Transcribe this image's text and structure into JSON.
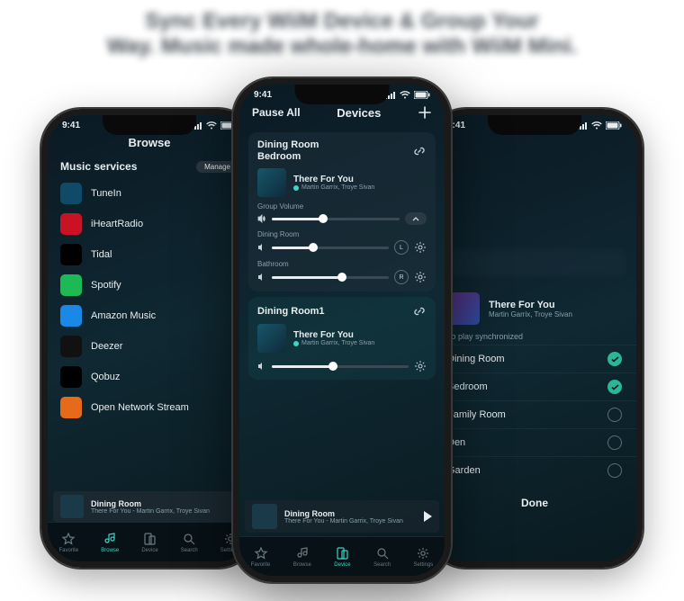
{
  "headline_line1": "Sync Every WiiM Device & Group Your",
  "headline_line2": "Way. Music made whole-home with WiiM Mini.",
  "status_time": "9:41",
  "left": {
    "title": "Browse",
    "section": "Music services",
    "manage": "Manage",
    "services": [
      {
        "name": "TuneIn",
        "bg": "#0f4b68",
        "fg": "#ffffff"
      },
      {
        "name": "iHeartRadio",
        "bg": "#c91224",
        "fg": "#ffffff"
      },
      {
        "name": "Tidal",
        "bg": "#000000",
        "fg": "#ffffff"
      },
      {
        "name": "Spotify",
        "bg": "#1db954",
        "fg": "#ffffff"
      },
      {
        "name": "Amazon Music",
        "bg": "#1a88e6",
        "fg": "#ffffff"
      },
      {
        "name": "Deezer",
        "bg": "#111111",
        "fg": "#ffffff"
      },
      {
        "name": "Qobuz",
        "bg": "#000000",
        "fg": "#ffffff"
      },
      {
        "name": "Open Network Stream",
        "bg": "#e66a1a",
        "fg": "#ffffff"
      }
    ],
    "nowplaying": {
      "room": "Dining Room",
      "track": "There For You - Martin Garrix, Troye Sivan"
    }
  },
  "center": {
    "pause_all": "Pause All",
    "title": "Devices",
    "card1": {
      "rooms": "Dining Room\nBedroom",
      "track": {
        "title": "There For You",
        "artist": "Martin Garrix, Troye Sivan"
      },
      "group_label": "Group Volume",
      "group_vol": 40,
      "room_a": {
        "name": "Dining Room",
        "vol": 35,
        "badge": "L"
      },
      "room_b": {
        "name": "Bathroom",
        "vol": 60,
        "badge": "R"
      }
    },
    "card2": {
      "room": "Dining Room1",
      "track": {
        "title": "There For You",
        "artist": "Martin Garrix, Troye Sivan"
      },
      "vol": 45
    },
    "nowplaying": {
      "room": "Dining Room",
      "track": "There For You - Martin Garrix, Troye Sivan"
    }
  },
  "right": {
    "track": {
      "title": "There For You",
      "artist": "Martin Garrix, Troye Sivan"
    },
    "sync_label": "To play synchronized",
    "rooms": [
      {
        "name": "Dining Room",
        "selected": true
      },
      {
        "name": "Bedroom",
        "selected": true
      },
      {
        "name": "Family Room",
        "selected": false
      },
      {
        "name": "Den",
        "selected": false
      },
      {
        "name": "Garden",
        "selected": false
      }
    ],
    "done": "Done"
  },
  "tabs": [
    {
      "label": "Favorite"
    },
    {
      "label": "Browse"
    },
    {
      "label": "Device"
    },
    {
      "label": "Search"
    },
    {
      "label": "Settings"
    }
  ]
}
